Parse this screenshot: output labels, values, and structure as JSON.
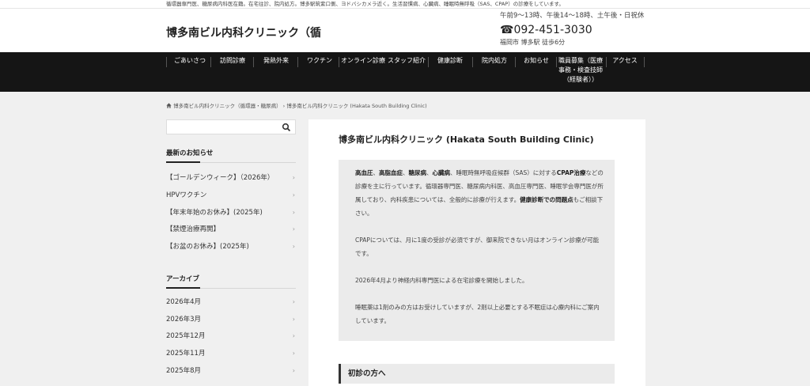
{
  "top_bar": {
    "text": "循環器専門医、糖尿病内科医在籍。在宅往診、院内処方。博多駅筑紫口側、ヨドバシカメラ近く。生活習慣病、心臓病、睡眠時無呼吸（SAS、CPAP）の診療をしています。"
  },
  "header": {
    "site_title": "博多南ビル内科クリニック（循",
    "hours": "午前9～13時、午後14～18時、土午後・日祝休",
    "phone_icon": "☎",
    "phone": "092-451-3030",
    "address": "福岡市 博多駅 徒歩6分"
  },
  "nav": {
    "items": [
      {
        "label": "ごあいさつ"
      },
      {
        "label": "訪問診療"
      },
      {
        "label": "発熱外来"
      },
      {
        "label": "ワクチン"
      },
      {
        "label": "オンライン診療"
      },
      {
        "label": "スタッフ紹介"
      },
      {
        "label": "健康診断"
      },
      {
        "label": "院内処方"
      },
      {
        "label": "お知らせ"
      },
      {
        "label": "職員募集（医療事務・検査技師（経験者））"
      },
      {
        "label": "アクセス"
      }
    ]
  },
  "breadcrumb": {
    "home_icon": "home-icon",
    "home": "博多南ビル内科クリニック（循環器・糖尿病）",
    "separator": "›",
    "current": "博多南ビル内科クリニック (Hakata South Building Clinic)"
  },
  "sidebar": {
    "search_placeholder": "",
    "news_heading": "最新のお知らせ",
    "news": [
      {
        "label": "【ゴールデンウィーク】（2026年）"
      },
      {
        "label": "HPVワクチン"
      },
      {
        "label": "【年末年始のお休み】(2025年)"
      },
      {
        "label": "【禁煙治療再開】"
      },
      {
        "label": "【お盆のお休み】(2025年)"
      }
    ],
    "archive_heading": "アーカイブ",
    "archives": [
      {
        "label": "2026年4月"
      },
      {
        "label": "2026年3月"
      },
      {
        "label": "2025年12月"
      },
      {
        "label": "2025年11月"
      },
      {
        "label": "2025年8月"
      }
    ],
    "chevron": "›"
  },
  "main": {
    "title": "博多南ビル内科クリニック (Hakata South Building Clinic)",
    "intro": {
      "b1": "高血圧",
      "s1": "、",
      "b2": "高脂血症",
      "s2": "、",
      "b3": "糖尿病",
      "s3": "、",
      "b4": "心臓病",
      "t1": "、睡眠時無呼吸症候群（SAS）に対する",
      "b5": "CPAP治療",
      "t2": "などの診療を主に行っています。循環器専門医、糖尿病内科医、高血圧専門医、睡眠学会専門医が所属しており、内科疾患については、全般的に診療が行えます。",
      "b6": "健康診断での問題点",
      "t3": "もご相談下さい。"
    },
    "p2": "CPAPについては、月に1度の受診が必須ですが、御来院できない月はオンライン診療が可能です。",
    "p3": "2026年4月より神経内科専門医による在宅診療を開始しました。",
    "p4": "睡眠薬は1剤のみの方はお受けしていますが、2剤以上必要とする不眠症は心療内科にご案内しています。",
    "section_heading": "初診の方へ"
  }
}
